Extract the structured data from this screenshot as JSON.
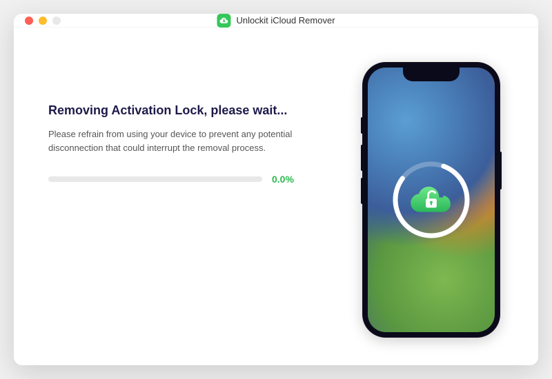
{
  "titlebar": {
    "app_title": "Unlockit iCloud Remover"
  },
  "main": {
    "heading": "Removing Activation Lock, please wait...",
    "description": "Please refrain from using your device to prevent any potential disconnection that could interrupt the removal process.",
    "progress_percent": "0.0%",
    "progress_value": 0
  },
  "colors": {
    "accent": "#34c759",
    "heading": "#1e1a4a"
  }
}
